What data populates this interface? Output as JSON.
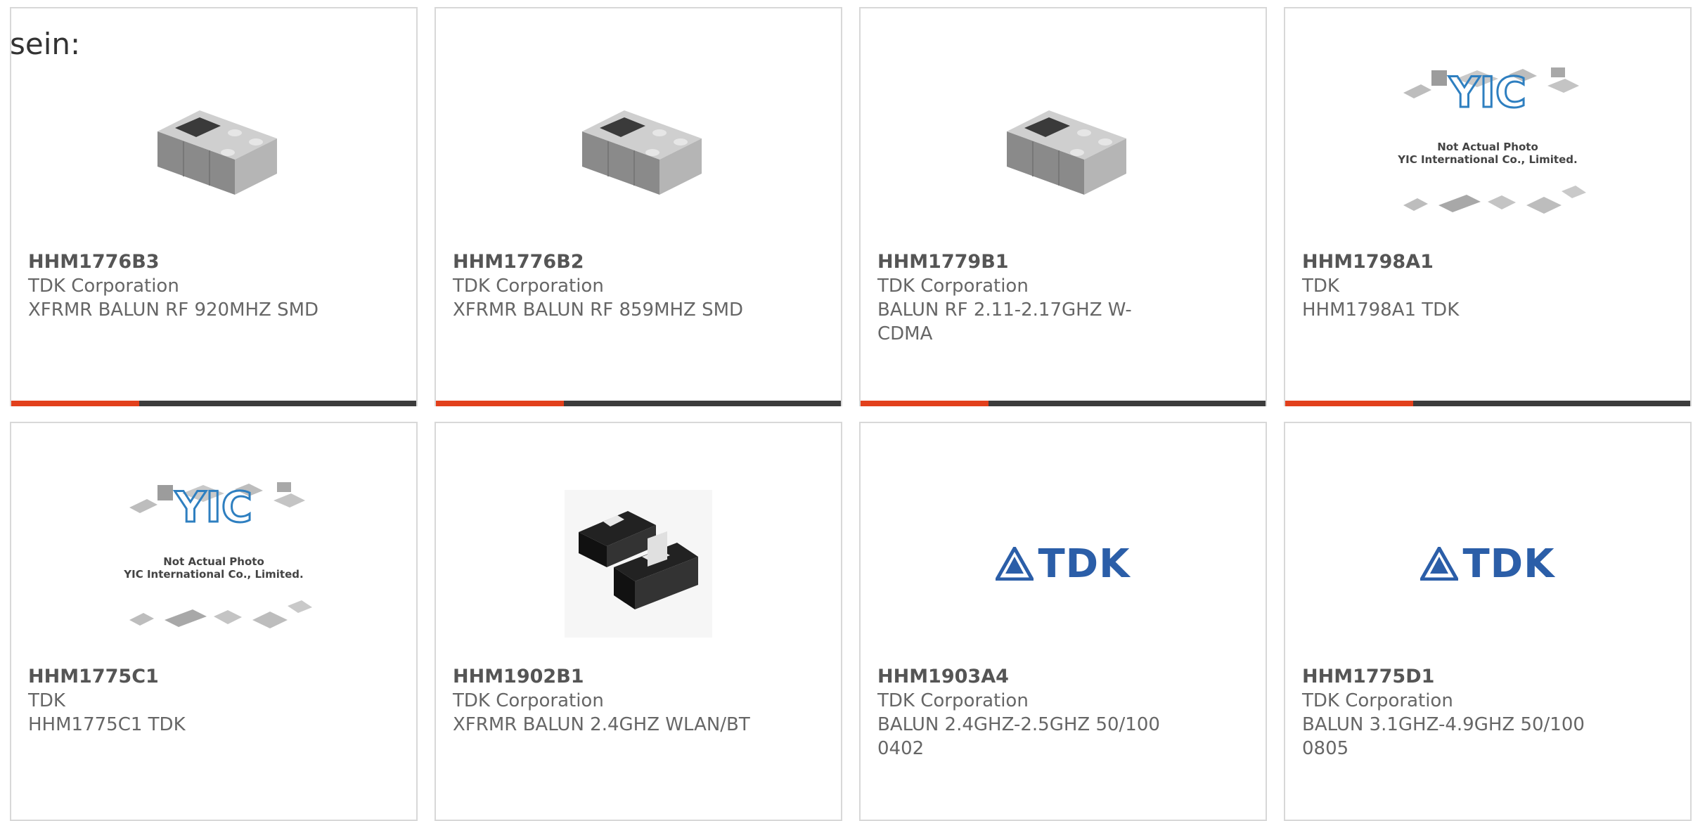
{
  "intro_text": "sein:",
  "colors": {
    "accent": "#e2401c",
    "bar": "#3c3c3c",
    "tdk_blue": "#2b5ea8",
    "yic_blue": "#2e7fc0"
  },
  "placeholder": {
    "line1": "Not Actual Photo",
    "line2": "YIC International Co., Limited."
  },
  "tdk_logo_text": "TDK",
  "products": [
    {
      "part": "HHM1776B3",
      "mfr": "TDK Corporation",
      "desc": "XFRMR BALUN RF 920MHZ SMD",
      "image": "smd-chip-grey"
    },
    {
      "part": "HHM1776B2",
      "mfr": "TDK Corporation",
      "desc": "XFRMR BALUN RF 859MHZ SMD",
      "image": "smd-chip-grey"
    },
    {
      "part": "HHM1779B1",
      "mfr": "TDK Corporation",
      "desc": "BALUN RF 2.11-2.17GHZ W-CDMA",
      "image": "smd-chip-grey"
    },
    {
      "part": "HHM1798A1",
      "mfr": "TDK",
      "desc": "HHM1798A1 TDK",
      "image": "yic-placeholder"
    },
    {
      "part": "HHM1775C1",
      "mfr": "TDK",
      "desc": "HHM1775C1 TDK",
      "image": "yic-placeholder"
    },
    {
      "part": "HHM1902B1",
      "mfr": "TDK Corporation",
      "desc": "XFRMR BALUN 2.4GHZ WLAN/BT",
      "image": "smd-pair-black"
    },
    {
      "part": "HHM1903A4",
      "mfr": "TDK Corporation",
      "desc": "BALUN 2.4GHZ-2.5GHZ 50/100 0402",
      "image": "tdk-logo"
    },
    {
      "part": "HHM1775D1",
      "mfr": "TDK Corporation",
      "desc": "BALUN 3.1GHZ-4.9GHZ 50/100 0805",
      "image": "tdk-logo"
    }
  ]
}
